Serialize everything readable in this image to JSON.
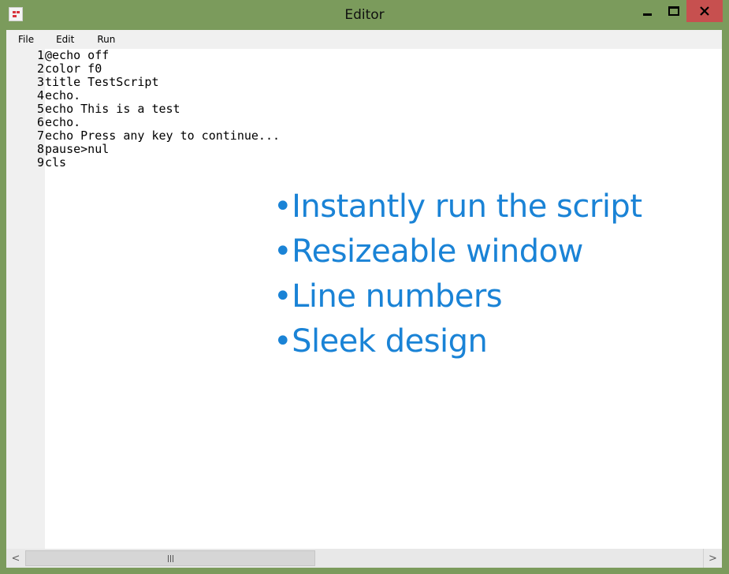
{
  "window": {
    "title": "Editor"
  },
  "menu": {
    "file": "File",
    "edit": "Edit",
    "run": "Run"
  },
  "editor": {
    "line_numbers": [
      "1",
      "2",
      "3",
      "4",
      "5",
      "6",
      "7",
      "8",
      "9"
    ],
    "lines": [
      "@echo off",
      "color f0",
      "title TestScript",
      "echo.",
      "echo This is a test",
      "echo.",
      "echo Press any key to continue...",
      "pause>nul",
      "cls"
    ]
  },
  "features": [
    "•Instantly run the script",
    "•Resizeable window",
    "•Line numbers",
    "•Sleek design"
  ],
  "scrollbar": {
    "left_arrow": "<",
    "right_arrow": ">"
  },
  "colors": {
    "frame": "#7b9b5c",
    "close_button": "#c7504f",
    "feature_text": "#1a83d6"
  }
}
